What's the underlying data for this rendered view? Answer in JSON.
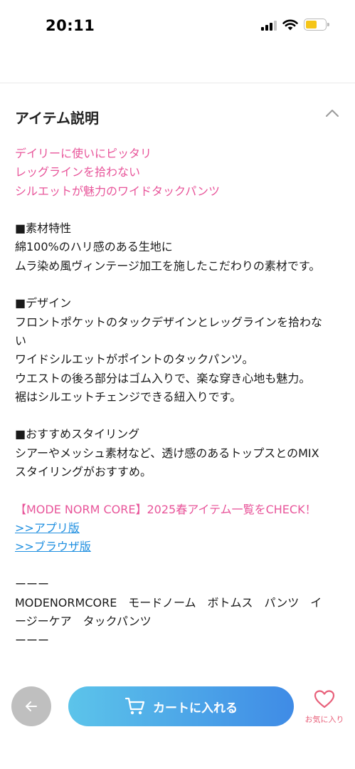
{
  "status_bar": {
    "time": "20:11"
  },
  "section": {
    "title": "アイテム説明"
  },
  "description": {
    "lines": [
      {
        "text": "デイリーに使いにピッタリ",
        "kind": "pink"
      },
      {
        "text": "レッグラインを拾わない",
        "kind": "pink"
      },
      {
        "text": "シルエットが魅力のワイドタックパンツ",
        "kind": "pink"
      },
      {
        "text": "",
        "kind": "blank"
      },
      {
        "text": "■素材特性",
        "kind": "text"
      },
      {
        "text": "綿100%のハリ感のある生地に",
        "kind": "text"
      },
      {
        "text": "ムラ染め風ヴィンテージ加工を施したこだわりの素材です。",
        "kind": "text"
      },
      {
        "text": "",
        "kind": "blank"
      },
      {
        "text": "■デザイン",
        "kind": "text"
      },
      {
        "text": "フロントポケットのタックデザインとレッグラインを拾わな",
        "kind": "text"
      },
      {
        "text": "い",
        "kind": "text"
      },
      {
        "text": "ワイドシルエットがポイントのタックパンツ。",
        "kind": "text"
      },
      {
        "text": "ウエストの後ろ部分はゴム入りで、楽な穿き心地も魅力。",
        "kind": "text"
      },
      {
        "text": "裾はシルエットチェンジできる紐入りです。",
        "kind": "text"
      },
      {
        "text": "",
        "kind": "blank"
      },
      {
        "text": "■おすすめスタイリング",
        "kind": "text"
      },
      {
        "text": "シアーやメッシュ素材など、透け感のあるトップスとのMIX",
        "kind": "text"
      },
      {
        "text": "スタイリングがおすすめ。",
        "kind": "text"
      },
      {
        "text": "",
        "kind": "blank"
      },
      {
        "text": "【MODE NORM CORE】2025春アイテム一覧をCHECK！",
        "kind": "pink"
      },
      {
        "text": ">>アプリ版",
        "kind": "link"
      },
      {
        "text": ">>ブラウザ版",
        "kind": "link"
      },
      {
        "text": "",
        "kind": "blank"
      },
      {
        "text": "ーーー",
        "kind": "text"
      },
      {
        "text": "MODENORMCORE　モードノーム　ボトムス　パンツ　イ",
        "kind": "text"
      },
      {
        "text": "ージーケア　タックパンツ",
        "kind": "text"
      },
      {
        "text": "ーーー",
        "kind": "text"
      }
    ]
  },
  "bottom_bar": {
    "cart_label": "カートに入れる",
    "favorite_label": "お気に入り"
  },
  "icons": {
    "back": "arrow-left-icon",
    "cart": "cart-icon",
    "favorite": "heart-icon",
    "collapse": "chevron-up-icon"
  },
  "colors": {
    "accent_pink": "#e8559a",
    "link_blue": "#1f8fe0",
    "cart_gradient_start": "#5cc4ea",
    "cart_gradient_end": "#3f8be6",
    "back_button_gray": "#bfbfbf",
    "favorite_red": "#e8607a"
  }
}
